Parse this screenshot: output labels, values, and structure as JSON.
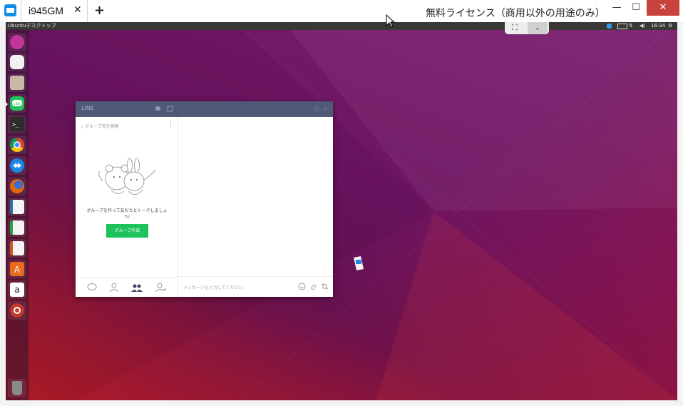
{
  "host": {
    "tab_label": "i945GM",
    "tab_close": "✕",
    "add_tab": "+",
    "license_text": "無料ライセンス（商用以外の用途のみ）",
    "minimize": "—",
    "maximize": "☐",
    "close": "✕"
  },
  "desktop": {
    "title": "Ubuntuデスクトップ",
    "clock": "16:34",
    "launcher": [
      {
        "name": "dash-home-icon",
        "color": "#c2359a"
      },
      {
        "name": "messaging-icon",
        "color": "#7a6a8a"
      },
      {
        "name": "files-icon",
        "color": "#b8a89a"
      },
      {
        "name": "line-icon",
        "color": "#22c35a"
      },
      {
        "name": "terminal-icon",
        "color": "#2c2c2c"
      },
      {
        "name": "chrome-icon",
        "color": "#e8b000"
      },
      {
        "name": "teamviewer-icon",
        "color": "#1b87e6"
      },
      {
        "name": "firefox-icon",
        "color": "#e6660c"
      },
      {
        "name": "writer-icon",
        "color": "#2f6fb6"
      },
      {
        "name": "calc-icon",
        "color": "#2aa34a"
      },
      {
        "name": "impress-icon",
        "color": "#d2582a"
      },
      {
        "name": "software-center-icon",
        "color": "#e86a1e"
      },
      {
        "name": "amazon-icon",
        "color": "#ffffff"
      },
      {
        "name": "system-settings-icon",
        "color": "#c0392b"
      },
      {
        "name": "trash-icon",
        "color": "#6b6b6b"
      }
    ]
  },
  "line": {
    "title": "LINE",
    "search_placeholder": "グループ名を検索",
    "empty_message": "グループを作って友だちとトークしましょう!",
    "create_group_button": "グループ作成",
    "message_placeholder": "メッセージを入力してください。",
    "accent_color": "#1dc35a"
  }
}
